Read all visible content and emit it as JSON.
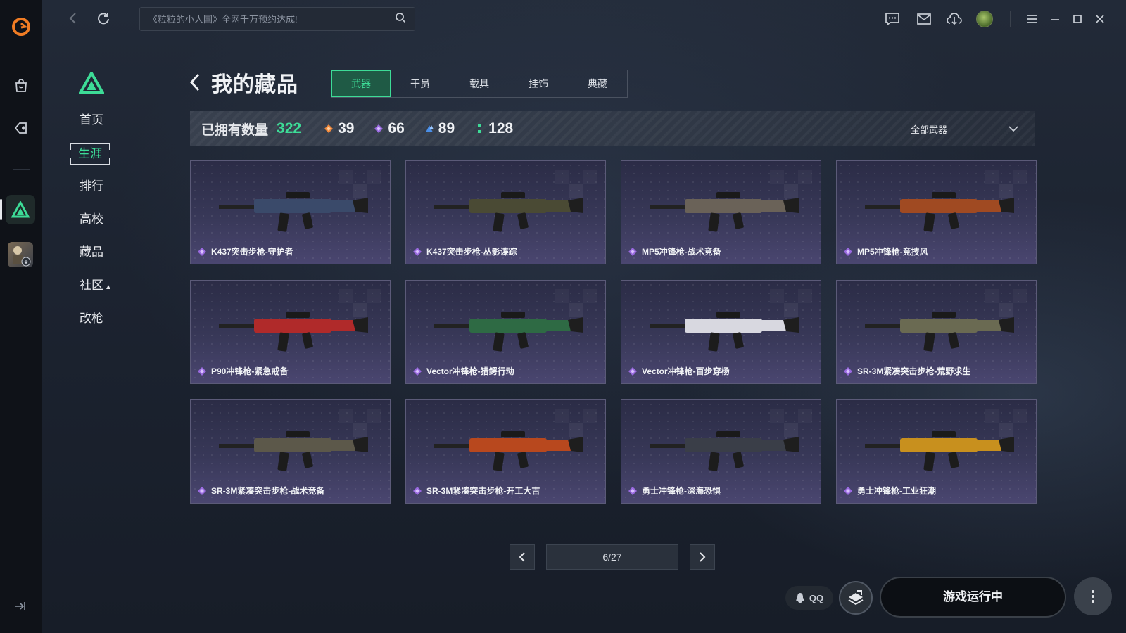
{
  "app": {
    "brand_color": "#f07c24",
    "accent": "#3ddc97"
  },
  "search": {
    "placeholder": "《粒粒的小人国》全网千万预约达成!"
  },
  "menu": {
    "items": [
      {
        "label": "首页"
      },
      {
        "label": "生涯"
      },
      {
        "label": "排行"
      },
      {
        "label": "高校"
      },
      {
        "label": "藏品"
      },
      {
        "label": "社区"
      },
      {
        "label": "改枪"
      }
    ]
  },
  "page": {
    "title": "我的藏品"
  },
  "tabs": [
    {
      "label": "武器",
      "active": true
    },
    {
      "label": "干员"
    },
    {
      "label": "载具"
    },
    {
      "label": "挂饰"
    },
    {
      "label": "典藏"
    }
  ],
  "stats": {
    "owned_label": "已拥有数量",
    "owned_count": "322",
    "rarities": [
      {
        "count": "39",
        "color": "#f0883a"
      },
      {
        "count": "66",
        "color": "#9a6ae0"
      },
      {
        "count": "89",
        "color": "#4a8fe8"
      },
      {
        "count": "128",
        "color": "#3ddc97"
      }
    ],
    "filter_label": "全部武器"
  },
  "items": [
    {
      "name": "K437突击步枪-守护者",
      "color": "#3a4a6a"
    },
    {
      "name": "K437突击步枪-丛影谍踪",
      "color": "#4a4a34"
    },
    {
      "name": "MP5冲锋枪-战术竞备",
      "color": "#6a6258"
    },
    {
      "name": "MP5冲锋枪-竞技风",
      "color": "#a04a22"
    },
    {
      "name": "P90冲锋枪-紧急戒备",
      "color": "#b02a2a"
    },
    {
      "name": "Vector冲锋枪-猎鳄行动",
      "color": "#2e6a44"
    },
    {
      "name": "Vector冲锋枪-百步穿杨",
      "color": "#d8d8e0"
    },
    {
      "name": "SR-3M紧凑突击步枪-荒野求生",
      "color": "#6a6a52"
    },
    {
      "name": "SR-3M紧凑突击步枪-战术竞备",
      "color": "#5c584a"
    },
    {
      "name": "SR-3M紧凑突击步枪-开工大吉",
      "color": "#b8481e"
    },
    {
      "name": "勇士冲锋枪-深海恐惧",
      "color": "#3a3e48"
    },
    {
      "name": "勇士冲锋枪-工业狂潮",
      "color": "#c8901e"
    }
  ],
  "pager": {
    "text": "6/27"
  },
  "bottom": {
    "qq_label": "QQ",
    "launch_label": "游戏运行中"
  }
}
